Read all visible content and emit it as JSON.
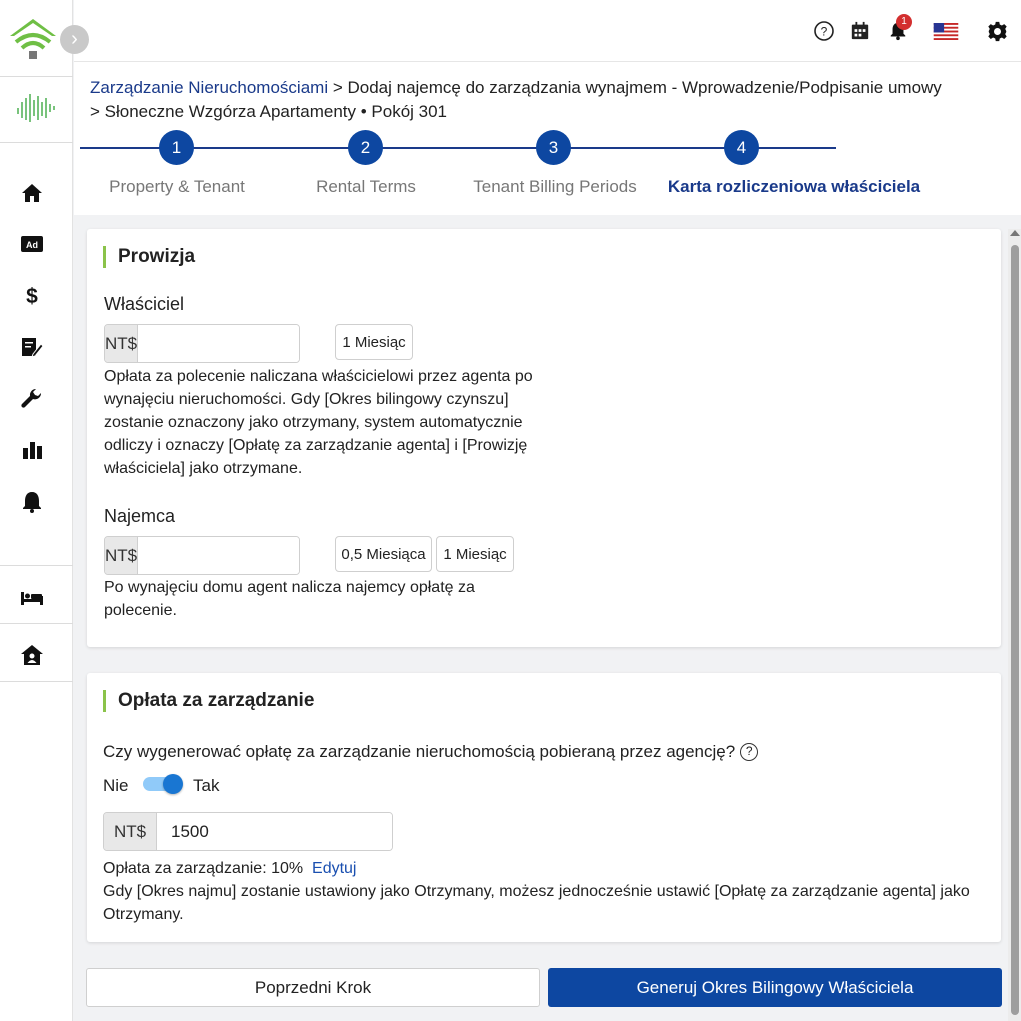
{
  "header": {
    "icons": [
      "help-circle-icon",
      "calendar-icon",
      "bell-icon",
      "us-flag-icon",
      "gear-icon"
    ],
    "notification_count": "1"
  },
  "sidebar": {
    "items": [
      "home-icon",
      "ad-icon",
      "dollar-icon",
      "contract-edit-icon",
      "wrench-icon",
      "bar-chart-icon",
      "bell-icon",
      "bed-icon",
      "house-icon"
    ]
  },
  "breadcrumb": {
    "root": "Zarządzanie Nieruchomościami",
    "line1_rest": " > Dodaj najemcę do zarządzania wynajmem - Wprowadzenie/Podpisanie umowy",
    "line2": "> Słoneczne Wzgórza Apartamenty • Pokój 301"
  },
  "stepper": {
    "steps": [
      {
        "number": "1",
        "label": "Property & Tenant"
      },
      {
        "number": "2",
        "label": "Rental Terms"
      },
      {
        "number": "3",
        "label": "Tenant Billing Periods"
      },
      {
        "number": "4",
        "label": "Karta rozliczeniowa właściciela"
      }
    ],
    "active_step": 4
  },
  "commission": {
    "title": "Prowizja",
    "owner": {
      "label": "Właściciel",
      "currency": "NT$",
      "value": "",
      "quick_buttons": [
        "1 Miesiąc"
      ],
      "description": "Opłata za polecenie naliczana właścicielowi przez agenta po wynajęciu nieruchomości. Gdy [Okres bilingowy czynszu] zostanie oznaczony jako otrzymany, system automatycznie odliczy i oznaczy [Opłatę za zarządzanie agenta] i [Prowizję właściciela] jako otrzymane."
    },
    "tenant": {
      "label": "Najemca",
      "currency": "NT$",
      "value": "",
      "quick_buttons": [
        "0,5 Miesiąca",
        "1 Miesiąc"
      ],
      "description": "Po wynajęciu domu agent nalicza najemcy opłatę za polecenie."
    }
  },
  "management_fee": {
    "title": "Opłata za zarządzanie",
    "question": "Czy wygenerować opłatę za zarządzanie nieruchomością pobieraną przez agencję?",
    "toggle_off_label": "Nie",
    "toggle_on_label": "Tak",
    "enabled": true,
    "currency": "NT$",
    "amount": "1500",
    "rate_text": "Opłata za zarządzanie: 10%",
    "edit_link": "Edytuj",
    "note": "Gdy [Okres najmu] zostanie ustawiony jako Otrzymany, możesz jednocześnie ustawić [Opłatę za zarządzanie agenta] jako Otrzymany."
  },
  "footer": {
    "prev_button": "Poprzedni Krok",
    "generate_button": "Generuj Okres Bilingowy Właściciela"
  },
  "colors": {
    "primary": "#0d47a1",
    "accent_bar": "#8bc34a",
    "badge": "#d32f2f"
  }
}
